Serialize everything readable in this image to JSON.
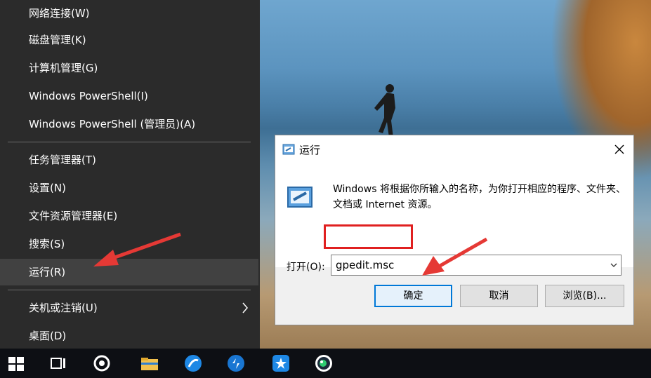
{
  "winx_menu": {
    "items": [
      {
        "label": "网络连接(W)"
      },
      {
        "label": "磁盘管理(K)"
      },
      {
        "label": "计算机管理(G)"
      },
      {
        "label": "Windows PowerShell(I)"
      },
      {
        "label": "Windows PowerShell (管理员)(A)"
      },
      {
        "label": "任务管理器(T)"
      },
      {
        "label": "设置(N)"
      },
      {
        "label": "文件资源管理器(E)"
      },
      {
        "label": "搜索(S)"
      },
      {
        "label": "运行(R)"
      },
      {
        "label": "关机或注销(U)"
      },
      {
        "label": "桌面(D)"
      }
    ],
    "active_item": "运行(R)"
  },
  "run_dialog": {
    "title": "运行",
    "description": "Windows 将根据你所输入的名称，为你打开相应的程序、文件夹、文档或 Internet 资源。",
    "open_label": "打开(O):",
    "command_value": "gpedit.msc",
    "ok_label": "确定",
    "cancel_label": "取消",
    "browse_label": "浏览(B)..."
  },
  "taskbar": {
    "icons": [
      "windows-start-icon",
      "task-view-icon",
      "app-icon",
      "file-explorer-icon",
      "browser-icon",
      "app-icon",
      "app-icon",
      "app-icon"
    ]
  },
  "colors": {
    "menu_bg": "#2b2b2b",
    "accent": "#0078d7",
    "highlight_box": "#e02020",
    "arrow": "#e53935"
  }
}
